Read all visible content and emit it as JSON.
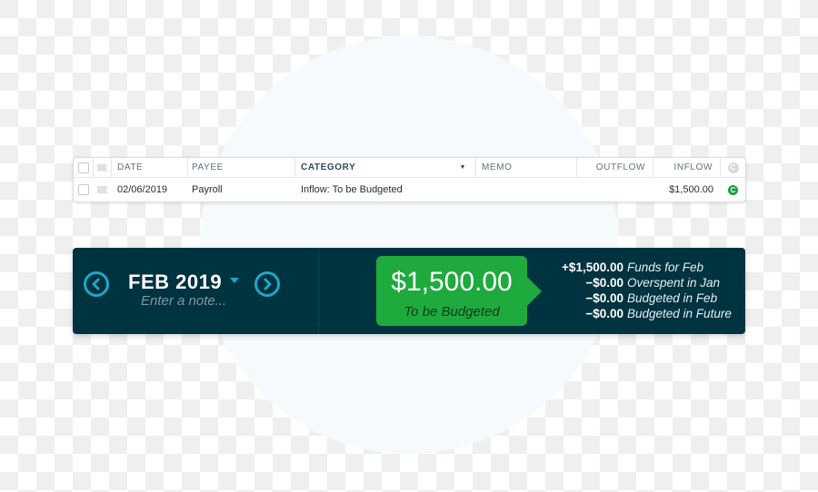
{
  "register": {
    "columns": {
      "date": "DATE",
      "payee": "PAYEE",
      "category": "CATEGORY",
      "memo": "MEMO",
      "outflow": "OUTFLOW",
      "inflow": "INFLOW",
      "cleared": "C"
    },
    "rows": [
      {
        "date": "02/06/2019",
        "payee": "Payroll",
        "category": "Inflow: To be Budgeted",
        "memo": "",
        "outflow": "",
        "inflow": "$1,500.00",
        "cleared": "C"
      }
    ]
  },
  "budget": {
    "month": "FEB 2019",
    "note_placeholder": "Enter a note...",
    "to_be_budgeted": {
      "amount": "$1,500.00",
      "label": "To be Budgeted",
      "color": "#1faa3d"
    },
    "breakdown": [
      {
        "amount": "+$1,500.00",
        "label": "Funds for Feb"
      },
      {
        "amount": "−$0.00",
        "label": "Overspent in Jan"
      },
      {
        "amount": "−$0.00",
        "label": "Budgeted in Feb"
      },
      {
        "amount": "−$0.00",
        "label": "Budgeted in Future"
      }
    ],
    "colors": {
      "bar_bg": "#003340",
      "accent": "#20a6c8"
    }
  }
}
